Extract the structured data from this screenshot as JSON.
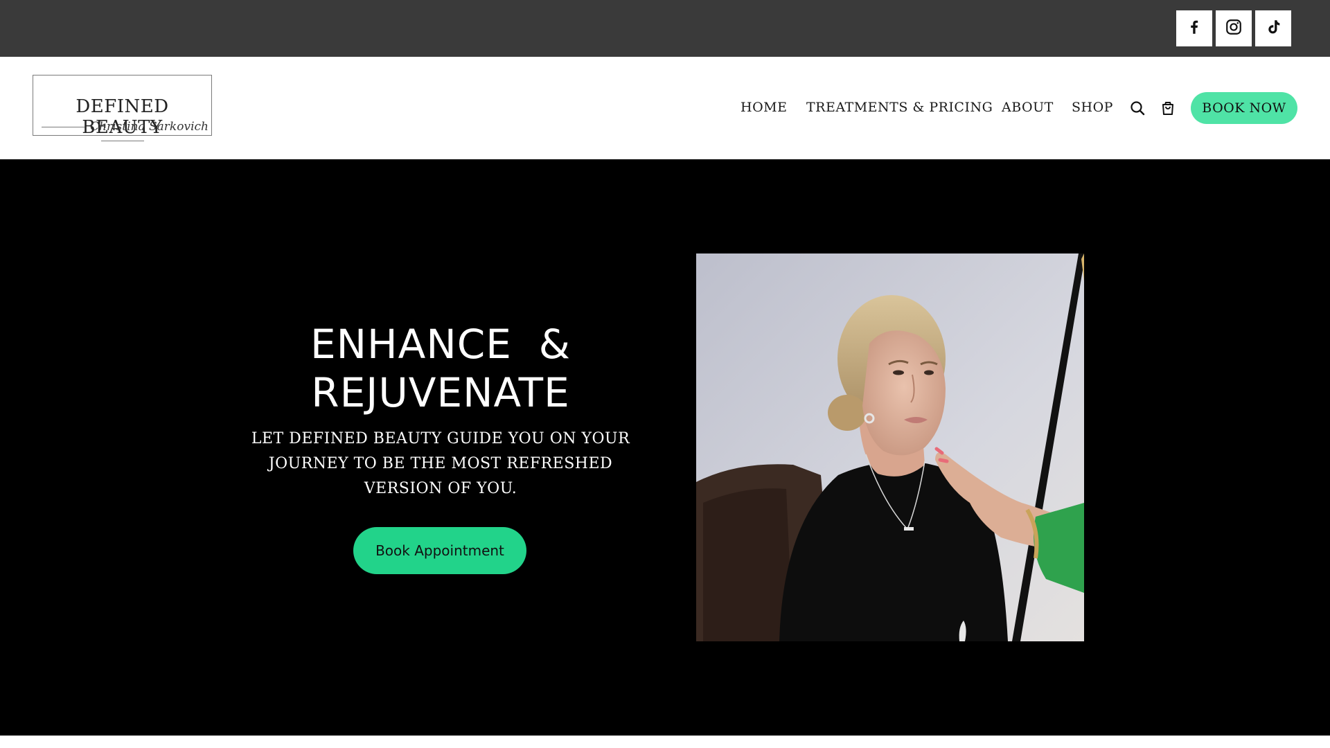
{
  "topbar": {
    "social": [
      {
        "name": "facebook",
        "icon": "facebook-icon"
      },
      {
        "name": "instagram",
        "icon": "instagram-icon"
      },
      {
        "name": "tiktok",
        "icon": "tiktok-icon"
      }
    ]
  },
  "header": {
    "logo": {
      "title": "DEFINED BEAUTY",
      "signature": "Christina Sarkovich"
    },
    "nav": {
      "home": "HOME",
      "treatments": "TREATMENTS & PRICING",
      "about": "ABOUT",
      "shop": "SHOP"
    },
    "icons": {
      "search": "search-icon",
      "cart": "cart-icon"
    },
    "book_now": "BOOK NOW"
  },
  "hero": {
    "title_line1": "ENHANCE  &",
    "title_line2": "REJUVENATE",
    "subtitle": "LET DEFINED BEAUTY GUIDE YOU ON YOUR JOURNEY TO BE THE MOST REFRESHED VERSION OF YOU.",
    "cta": "Book Appointment"
  },
  "colors": {
    "topbar": "#3a3a3a",
    "accent": "#4fe3a6",
    "cta": "#22d38a",
    "hero_bg": "#000000"
  }
}
